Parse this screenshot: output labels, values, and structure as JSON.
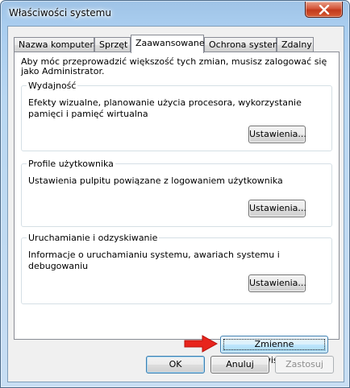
{
  "window": {
    "title": "Właściwości systemu",
    "close_glyph": "✕"
  },
  "tabs": [
    {
      "label": "Nazwa komputera"
    },
    {
      "label": "Sprzęt"
    },
    {
      "label": "Zaawansowane"
    },
    {
      "label": "Ochrona systemu"
    },
    {
      "label": "Zdalny"
    }
  ],
  "active_tab": "Zaawansowane",
  "advanced": {
    "intro": "Aby móc przeprowadzić większość tych zmian, musisz zalogować się jako Administrator.",
    "performance": {
      "label": "Wydajność",
      "text": "Efekty wizualne, planowanie użycia procesora, wykorzystanie pamięci i pamięć wirtualna",
      "button": "Ustawienia..."
    },
    "profiles": {
      "label": "Profile użytkownika",
      "text": "Ustawienia pulpitu powiązane z logowaniem użytkownika",
      "button": "Ustawienia..."
    },
    "startup": {
      "label": "Uruchamianie i odzyskiwanie",
      "text": "Informacje o uruchamianiu systemu, awariach systemu i debugowaniu",
      "button": "Ustawienia..."
    },
    "env_button": "Zmienne środowiskowe..."
  },
  "dialog_buttons": {
    "ok": "OK",
    "cancel": "Anuluj",
    "apply": "Zastosuj"
  },
  "colors": {
    "arrow": "#e8241c",
    "close_button": "#c8452a"
  }
}
